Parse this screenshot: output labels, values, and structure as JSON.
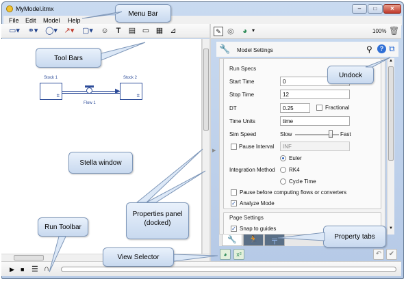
{
  "window": {
    "title": "MyModel.itmx",
    "minimize_glyph": "–",
    "maximize_glyph": "□",
    "close_glyph": "✕"
  },
  "menu": [
    "File",
    "Edit",
    "Model",
    "Help"
  ],
  "toolbar_left": {
    "icons": [
      "stock-tool-icon",
      "flow-tool-icon",
      "converter-tool-icon",
      "connector-tool-icon",
      "module-tool-icon",
      "ghost-tool-icon",
      "text-tool-icon",
      "input-device-icon",
      "slider-icon",
      "table-icon",
      "graph-icon"
    ]
  },
  "toolbar_right": {
    "zoom": "100%"
  },
  "model": {
    "stock1_label": "Stock 1",
    "stock2_label": "Stock 2",
    "flow_label": "Flow 1",
    "stock_sign": "±"
  },
  "panel": {
    "title": "Model Settings",
    "run_specs": {
      "section": "Run Specs",
      "start_time_label": "Start Time",
      "start_time": "0",
      "stop_time_label": "Stop Time",
      "stop_time": "12",
      "dt_label": "DT",
      "dt": "0.25",
      "fractional_label": "Fractional",
      "time_units_label": "Time Units",
      "time_units": "time",
      "sim_speed_label": "Sim Speed",
      "slow": "Slow",
      "fast": "Fast",
      "sim_speed_level": 0.82,
      "pause_interval_label": "Pause Interval",
      "pause_interval": "INF",
      "integration_label": "Integration Method",
      "methods": [
        "Euler",
        "RK4",
        "Cycle Time"
      ],
      "selected_method": "Euler",
      "pause_before_label": "Pause before computing flows or converters",
      "analyze_mode_label": "Analyze Mode",
      "analyze_mode": true,
      "fractional": false,
      "pause_interval_checked": false,
      "pause_before_checked": false
    },
    "page_settings": {
      "section": "Page Settings",
      "snap_label": "Snap to guides",
      "snap_checked": true
    }
  },
  "callouts": {
    "menu_bar": "Menu Bar",
    "tool_bars": "Tool Bars",
    "undock": "Undock",
    "stella_window": "Stella window",
    "properties_panel": "Properties panel\n(docked)",
    "run_toolbar": "Run Toolbar",
    "view_selector": "View Selector",
    "property_tabs": "Property tabs"
  },
  "colors": {
    "model_blue": "#2d4c99",
    "callout_fill": "#dce8f7",
    "accent_blue": "#1e4fa8",
    "close_red": "#c0392b"
  }
}
